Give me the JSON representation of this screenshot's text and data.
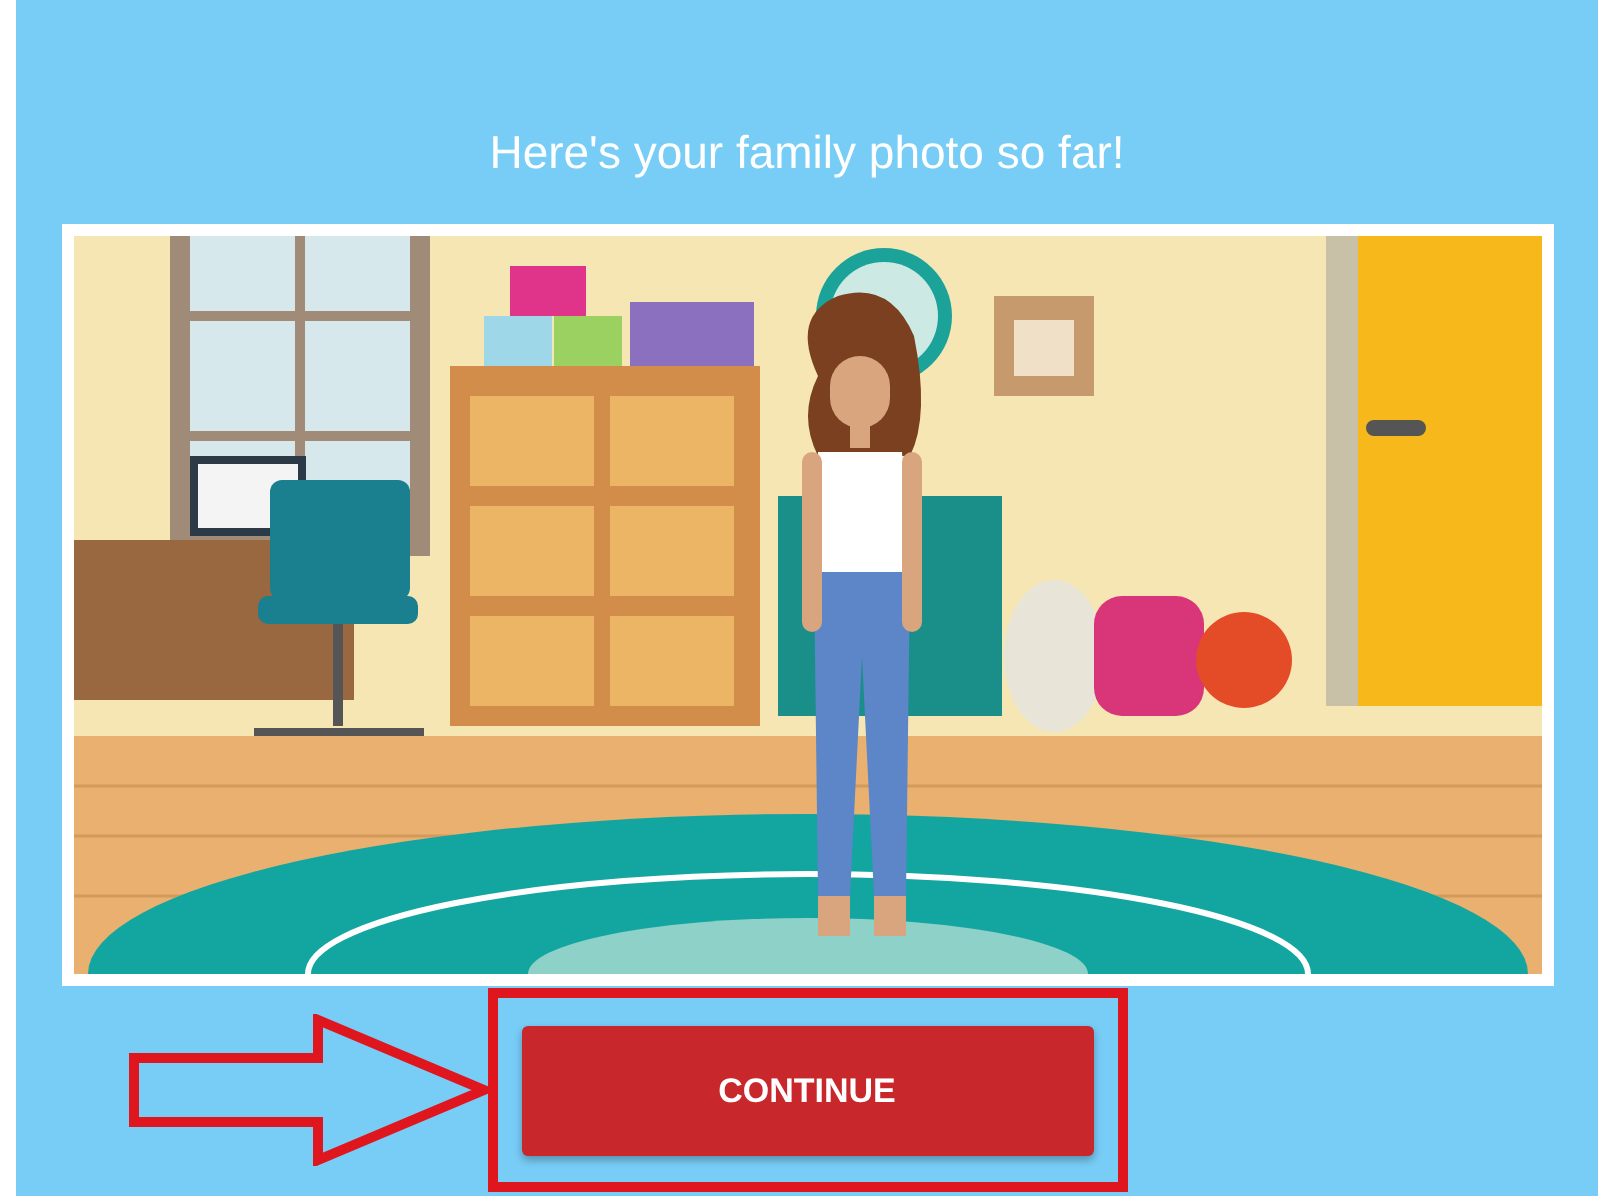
{
  "heading": "Here's your family photo so far!",
  "button": {
    "label": "CONTINUE"
  }
}
